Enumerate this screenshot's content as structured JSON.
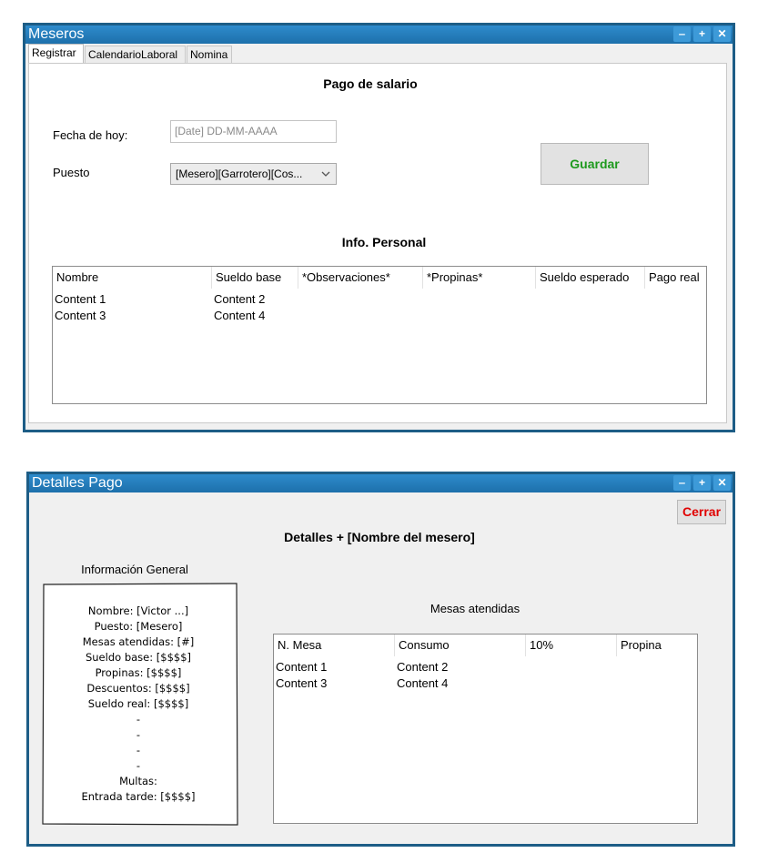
{
  "win1": {
    "title": "Meseros",
    "tabs": [
      {
        "label": "Registrar"
      },
      {
        "label": "CalendarioLaboral"
      },
      {
        "label": "Nomina"
      }
    ],
    "heading": "Pago de salario",
    "fecha_label": "Fecha de hoy:",
    "fecha_placeholder": "[Date] DD-MM-AAAA",
    "puesto_label": "Puesto",
    "puesto_value": "[Mesero][Garrotero][Cos...",
    "guardar_label": "Guardar",
    "info_heading": "Info. Personal",
    "table": {
      "headers": [
        "Nombre",
        "Sueldo base",
        "*Observaciones*",
        "*Propinas*",
        "Sueldo esperado",
        "Pago real"
      ],
      "rows": [
        [
          "Content 1",
          "Content 2"
        ],
        [
          "Content 3",
          "Content 4"
        ]
      ]
    }
  },
  "win2": {
    "title": "Detalles Pago",
    "cerrar_label": "Cerrar",
    "heading": "Detalles + [Nombre del mesero]",
    "info_general_label": "Información General",
    "receipt_lines": [
      "Nombre: [Victor ...]",
      "Puesto: [Mesero]",
      "Mesas atendidas: [#]",
      "Sueldo base: [$$$$]",
      "Propinas: [$$$$]",
      "Descuentos: [$$$$]",
      "Sueldo real: [$$$$]",
      "-",
      "-",
      "-",
      "-",
      "Multas:",
      "Entrada tarde: [$$$$]"
    ],
    "mesas_label": "Mesas atendidas",
    "table": {
      "headers": [
        "N. Mesa",
        "Consumo",
        "10%",
        "Propina"
      ],
      "rows": [
        [
          "Content 1",
          "Content 2"
        ],
        [
          "Content 3",
          "Content 4"
        ]
      ]
    }
  },
  "colors": {
    "title_bar": "#1d70ab",
    "border": "#1d5d86",
    "guardar_text": "#1e9a1e",
    "cerrar_text": "#e00000"
  },
  "icons": [
    "minimize-icon",
    "maximize-icon",
    "close-icon",
    "chevron-down-icon"
  ]
}
